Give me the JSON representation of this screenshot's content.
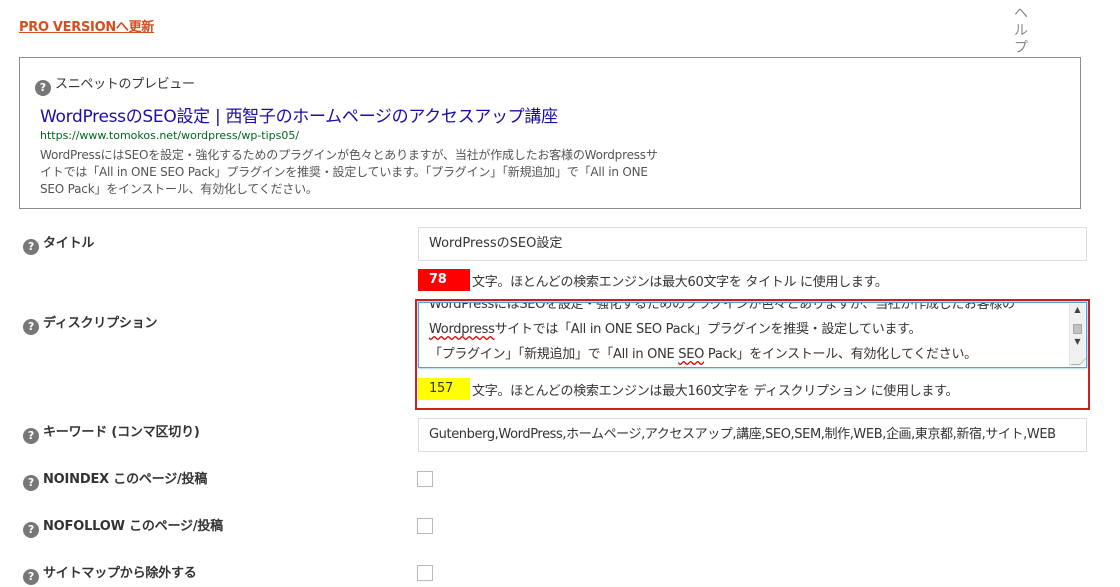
{
  "upgrade": {
    "label": "PRO VERSIONへ更新"
  },
  "help_tab": {
    "chars": [
      "ヘ",
      "ル",
      "プ"
    ]
  },
  "snippet": {
    "heading": "スニペットのプレビュー",
    "title": "WordPressのSEO設定 | 西智子のホームページのアクセスアップ講座",
    "url": "https://www.tomokos.net/wordpress/wp-tips05/",
    "description": "WordPressにはSEOを設定・強化するためのプラグインが色々とありますが、当社が作成したお客様のWordpressサイトでは「All in ONE SEO Pack」プラグインを推奨・設定しています。「プラグイン」「新規追加」で「All in ONE SEO Pack」をインストール、有効化してください。"
  },
  "fields": {
    "title": {
      "label": "タイトル",
      "value": "WordPressのSEO設定",
      "count": "78",
      "counter_text": "文字。ほとんどの検索エンジンは最大60文字を タイトル に使用します。"
    },
    "description": {
      "label": "ディスクリプション",
      "lines": [
        "WordPressにはSEOを設定・強化するためのプラグインが色々とありますが、当社が作成したお客様の",
        "Wordpressサイトでは「All in ONE SEO Pack」プラグインを推奨・設定しています。",
        "「プラグイン」「新規追加」で「All in ONE SEO Pack」をインストール、有効化してください。"
      ],
      "count": "157",
      "counter_text": "文字。ほとんどの検索エンジンは最大160文字を ディスクリプション に使用します。"
    },
    "keywords": {
      "label": "キーワード (コンマ区切り)",
      "value": "Gutenberg,WordPress,ホームページ,アクセスアップ,講座,SEO,SEM,制作,WEB,企画,東京都,新宿,サイト,WEB"
    },
    "noindex": {
      "label": "NOINDEX このページ/投稿",
      "checked": false
    },
    "nofollow": {
      "label": "NOFOLLOW このページ/投稿",
      "checked": false
    },
    "sitemap_exclude": {
      "label": "サイトマップから除外する",
      "checked": false
    }
  },
  "colors": {
    "link": "#1a0dab",
    "url": "#006621",
    "upgrade": "#d54e21",
    "counter_over": "#ff0000",
    "counter_warn": "#ffff00",
    "highlight": "#cc1f1f"
  },
  "icons": {
    "help": "question-circle-icon",
    "glyph": "?"
  }
}
